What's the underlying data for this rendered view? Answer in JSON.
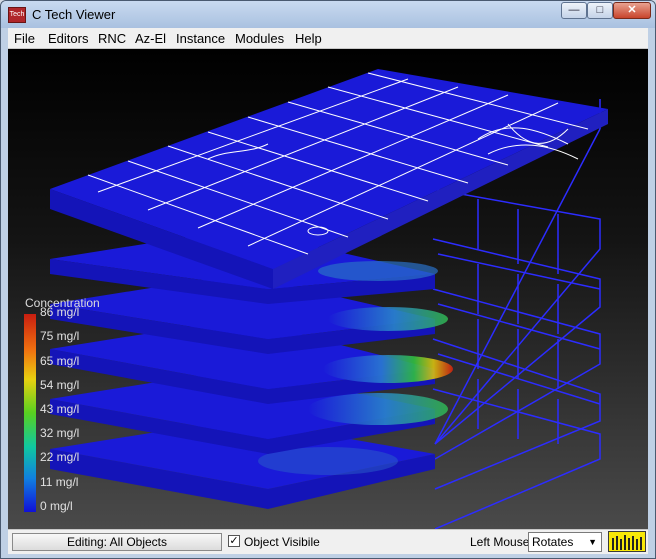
{
  "window": {
    "title": "C Tech Viewer",
    "icon_text": "Tech"
  },
  "menu": [
    {
      "label": "File"
    },
    {
      "label": "Editors"
    },
    {
      "label": "RNC"
    },
    {
      "label": "Az-El"
    },
    {
      "label": "Instance"
    },
    {
      "label": "Modules"
    },
    {
      "label": "Help"
    }
  ],
  "legend": {
    "title": "Concentration",
    "labels": [
      "86 mg/l",
      "75 mg/l",
      "65 mg/l",
      "54 mg/l",
      "43 mg/l",
      "32 mg/l",
      "22 mg/l",
      "11 mg/l",
      "0 mg/l"
    ]
  },
  "status": {
    "editing_label": "Editing: All Objects",
    "object_visible_label": "Object Visibile",
    "object_visible_checked": true,
    "left_mouse_label": "Left Mouse",
    "left_mouse_mode": "Rotates"
  },
  "colors": {
    "slab": "#1a1ad8",
    "wire": "#2c2cff",
    "map_lines": "#ffffff",
    "plume_high": "#d02010",
    "plume_mid": "#30c030"
  }
}
